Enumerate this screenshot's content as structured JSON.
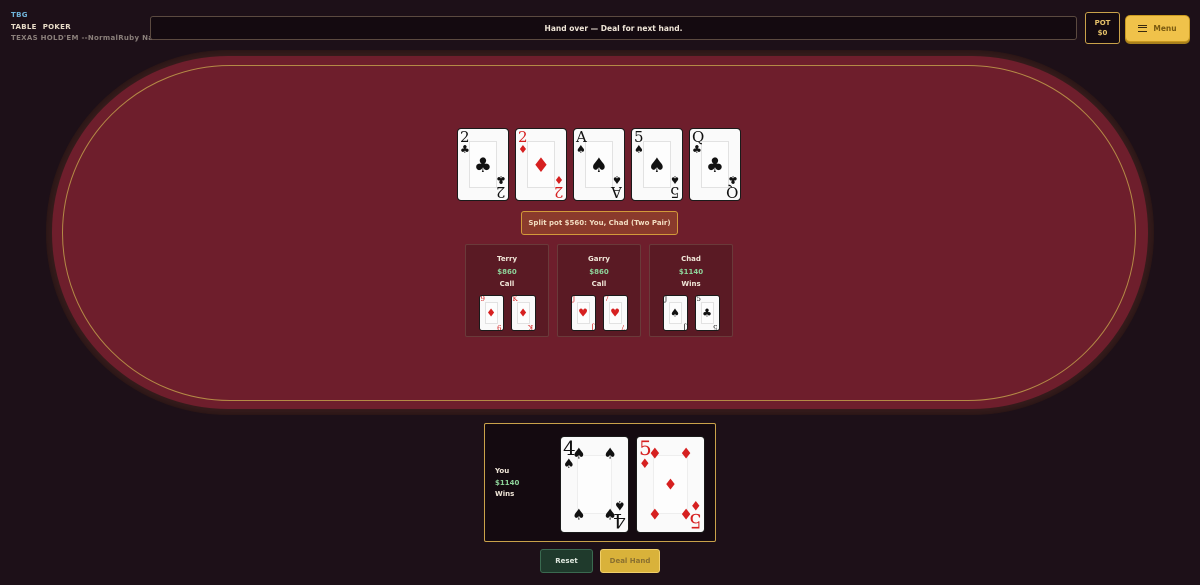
{
  "brand": {
    "code": "TBG",
    "line1a": "TABLE",
    "line1b": "POKER",
    "mode": "TEXAS HOLD'EM --NormalRuby Nair"
  },
  "status": "Hand over — Deal for next hand.",
  "pot": {
    "label": "POT",
    "value": "$0"
  },
  "menu": {
    "label": "Menu",
    "icon": "hamburger-icon"
  },
  "board": [
    {
      "rank": "2",
      "suit": "♣",
      "color": "black"
    },
    {
      "rank": "2",
      "suit": "♦",
      "color": "red"
    },
    {
      "rank": "A",
      "suit": "♠",
      "color": "black"
    },
    {
      "rank": "5",
      "suit": "♠",
      "color": "black"
    },
    {
      "rank": "Q",
      "suit": "♣",
      "color": "black"
    }
  ],
  "result_banner": "Split pot $560: You, Chad (Two Pair)",
  "seats": [
    {
      "name": "Terry",
      "chips": "$860",
      "action": "Call",
      "cards": [
        {
          "rank": "9",
          "suit": "♦",
          "color": "red"
        },
        {
          "rank": "K",
          "suit": "♦",
          "color": "red"
        }
      ]
    },
    {
      "name": "Garry",
      "chips": "$860",
      "action": "Call",
      "cards": [
        {
          "rank": "J",
          "suit": "♥",
          "color": "red"
        },
        {
          "rank": "7",
          "suit": "♥",
          "color": "red"
        }
      ]
    },
    {
      "name": "Chad",
      "chips": "$1140",
      "action": "Wins",
      "cards": [
        {
          "rank": "J",
          "suit": "♠",
          "color": "black"
        },
        {
          "rank": "5",
          "suit": "♣",
          "color": "black"
        }
      ]
    }
  ],
  "player": {
    "name": "You",
    "chips": "$1140",
    "action": "Wins",
    "cards": [
      {
        "rank": "4",
        "suit": "♠",
        "color": "black"
      },
      {
        "rank": "5",
        "suit": "♦",
        "color": "red"
      }
    ]
  },
  "buttons": {
    "reset": "Reset",
    "deal": "Deal Hand"
  },
  "colors": {
    "felt": "#6e1e2c",
    "rail": "#3a1e1e",
    "gold": "#c9a24a",
    "chips_green": "#8ed39a",
    "card_red": "#d62020"
  }
}
